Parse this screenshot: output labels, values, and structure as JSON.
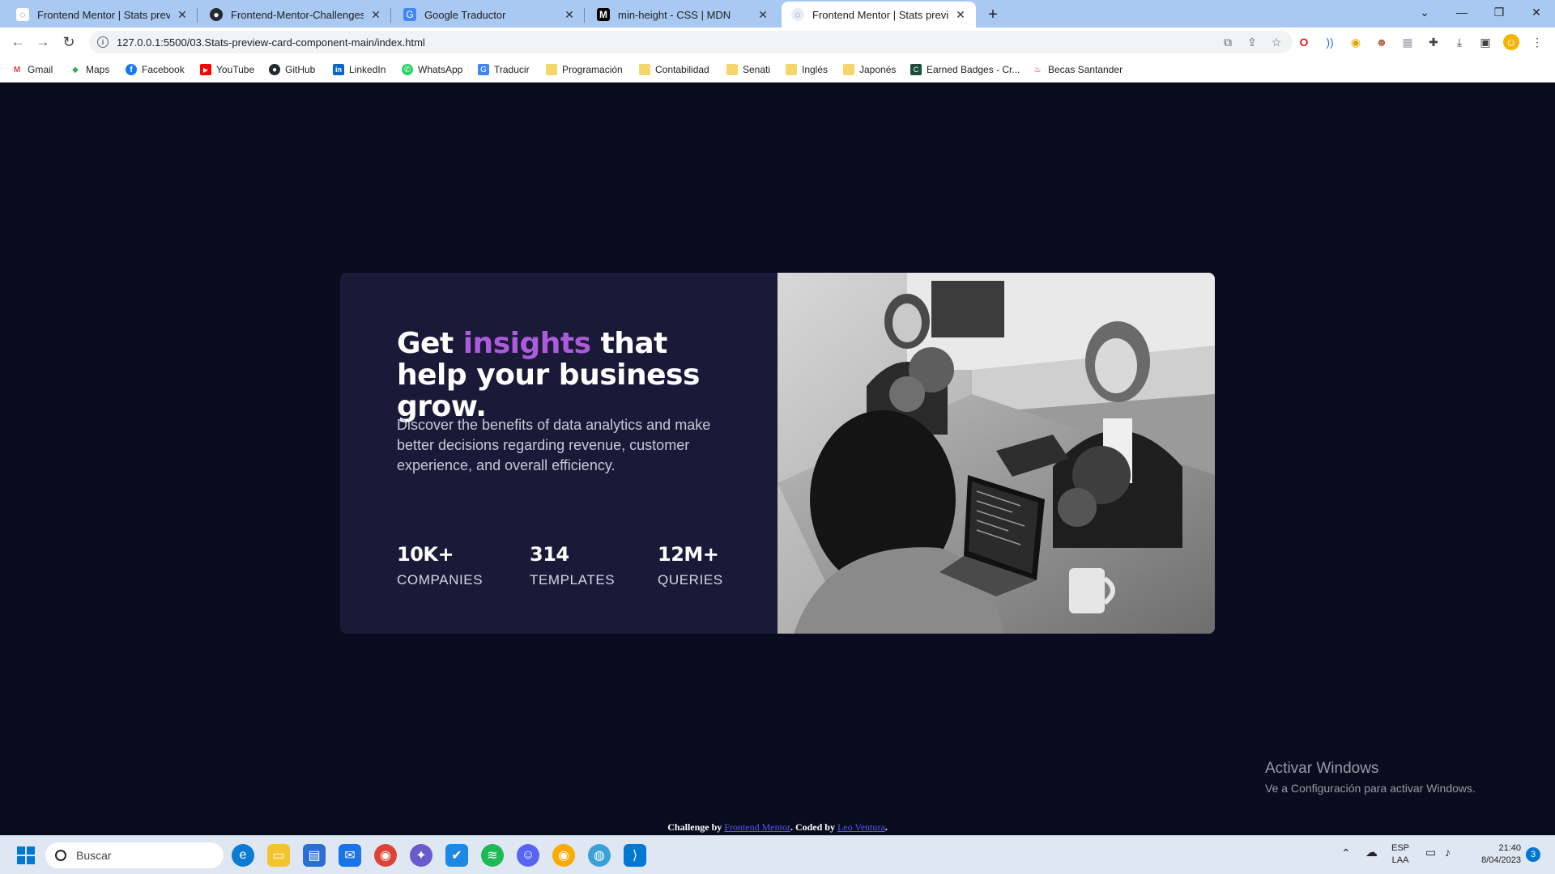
{
  "browser": {
    "tabs": [
      {
        "title": "Frontend Mentor | Stats preview",
        "icon": "fm-favicon",
        "active": false
      },
      {
        "title": "Frontend-Mentor-Challenges/sty",
        "icon": "github-icon",
        "active": false
      },
      {
        "title": "Google Traductor",
        "icon": "translate-icon",
        "active": false
      },
      {
        "title": "min-height - CSS | MDN",
        "icon": "mdn-icon",
        "active": false
      },
      {
        "title": "Frontend Mentor | Stats preview",
        "icon": "fm-favicon",
        "active": true
      }
    ],
    "url": "127.0.0.1:5500/03.Stats-preview-card-component-main/index.html",
    "bookmarks": [
      {
        "label": "Gmail",
        "icon": "gmail-icon",
        "color": "#ea4335"
      },
      {
        "label": "Maps",
        "icon": "maps-icon",
        "color": "#34a853"
      },
      {
        "label": "Facebook",
        "icon": "facebook-icon",
        "color": "#1877f2"
      },
      {
        "label": "YouTube",
        "icon": "youtube-icon",
        "color": "#ff0000"
      },
      {
        "label": "GitHub",
        "icon": "github-icon",
        "color": "#24292f"
      },
      {
        "label": "LinkedIn",
        "icon": "linkedin-icon",
        "color": "#0a66c2"
      },
      {
        "label": "WhatsApp",
        "icon": "whatsapp-icon",
        "color": "#25d366"
      },
      {
        "label": "Traducir",
        "icon": "translate-icon",
        "color": "#4285f4"
      },
      {
        "label": "Programación",
        "icon": "folder-icon",
        "color": "#f5d66b"
      },
      {
        "label": "Contabilidad",
        "icon": "folder-icon",
        "color": "#f5d66b"
      },
      {
        "label": "Senati",
        "icon": "folder-icon",
        "color": "#f5d66b"
      },
      {
        "label": "Inglés",
        "icon": "folder-icon",
        "color": "#f5d66b"
      },
      {
        "label": "Japonés",
        "icon": "folder-icon",
        "color": "#f5d66b"
      },
      {
        "label": "Earned Badges - Cr...",
        "icon": "credly-icon",
        "color": "#1b4d3e"
      },
      {
        "label": "Becas Santander",
        "icon": "santander-icon",
        "color": "#ec0000"
      }
    ]
  },
  "card": {
    "headline_pre": "Get ",
    "headline_accent": "insights",
    "headline_post": " that help your business grow.",
    "description": "Discover the benefits of data analytics and make better decisions regarding revenue, customer experience, and overall efficiency.",
    "stats": [
      {
        "value": "10K+",
        "label": "COMPANIES"
      },
      {
        "value": "314",
        "label": "TEMPLATES"
      },
      {
        "value": "12M+",
        "label": "QUERIES"
      }
    ],
    "colors": {
      "background": "#090b1e",
      "card": "#1b1938",
      "accent": "#aa5cdb"
    }
  },
  "attribution": {
    "prefix": "Challenge by ",
    "link1": "Frontend Mentor",
    "middle": ". Coded by ",
    "link2": "Leo Ventura",
    "suffix": "."
  },
  "watermark": {
    "title": "Activar Windows",
    "subtitle": "Ve a Configuración para activar Windows."
  },
  "taskbar": {
    "search_placeholder": "Buscar",
    "lang": "ESP",
    "lang_sub": "LAA",
    "time": "21:40",
    "date": "8/04/2023",
    "notifications": "3"
  }
}
